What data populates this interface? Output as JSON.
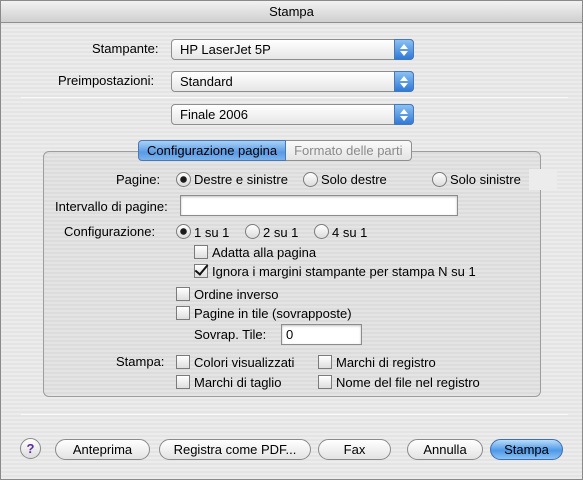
{
  "window": {
    "title": "Stampa"
  },
  "printer": {
    "label": "Stampante:",
    "value": "HP LaserJet 5P"
  },
  "presets": {
    "label": "Preimpostazioni:",
    "value": "Standard"
  },
  "pane": {
    "value": "Finale 2006"
  },
  "tabs": [
    {
      "label": "Configurazione pagina",
      "selected": true
    },
    {
      "label": "Formato delle parti",
      "selected": false
    }
  ],
  "pages": {
    "label": "Pagine:",
    "options": [
      {
        "label": "Destre e sinistre",
        "selected": true
      },
      {
        "label": "Solo destre",
        "selected": false
      },
      {
        "label": "Solo sinistre",
        "selected": false
      }
    ]
  },
  "page_range": {
    "label": "Intervallo di pagine:",
    "value": ""
  },
  "layout": {
    "label": "Configurazione:",
    "options": [
      {
        "label": "1 su 1",
        "selected": true
      },
      {
        "label": "2 su 1",
        "selected": false
      },
      {
        "label": "4 su 1",
        "selected": false
      }
    ],
    "fit_to_page": {
      "label": "Adatta alla pagina",
      "checked": false
    },
    "ignore_margins": {
      "label": "Ignora i margini stampante per stampa N su 1",
      "checked": true
    }
  },
  "reverse_order": {
    "label": "Ordine inverso",
    "checked": false
  },
  "tile_pages": {
    "label": "Pagine in tile (sovrapposte)",
    "checked": false
  },
  "tile_overlap": {
    "label": "Sovrap. Tile:",
    "value": "0"
  },
  "print": {
    "label": "Stampa:",
    "displayed_colors": {
      "label": "Colori visualizzati",
      "checked": false
    },
    "registration_marks": {
      "label": "Marchi di registro",
      "checked": false
    },
    "crop_marks": {
      "label": "Marchi di taglio",
      "checked": false
    },
    "file_name_in_registration": {
      "label": "Nome del file nel registro",
      "checked": false
    }
  },
  "buttons": {
    "help": "?",
    "preview": "Anteprima",
    "save_pdf": "Registra come PDF...",
    "fax": "Fax",
    "cancel": "Annulla",
    "print": "Stampa"
  },
  "colors": {
    "accent": "#4f98e8",
    "active_tab": "#5a9be6"
  }
}
